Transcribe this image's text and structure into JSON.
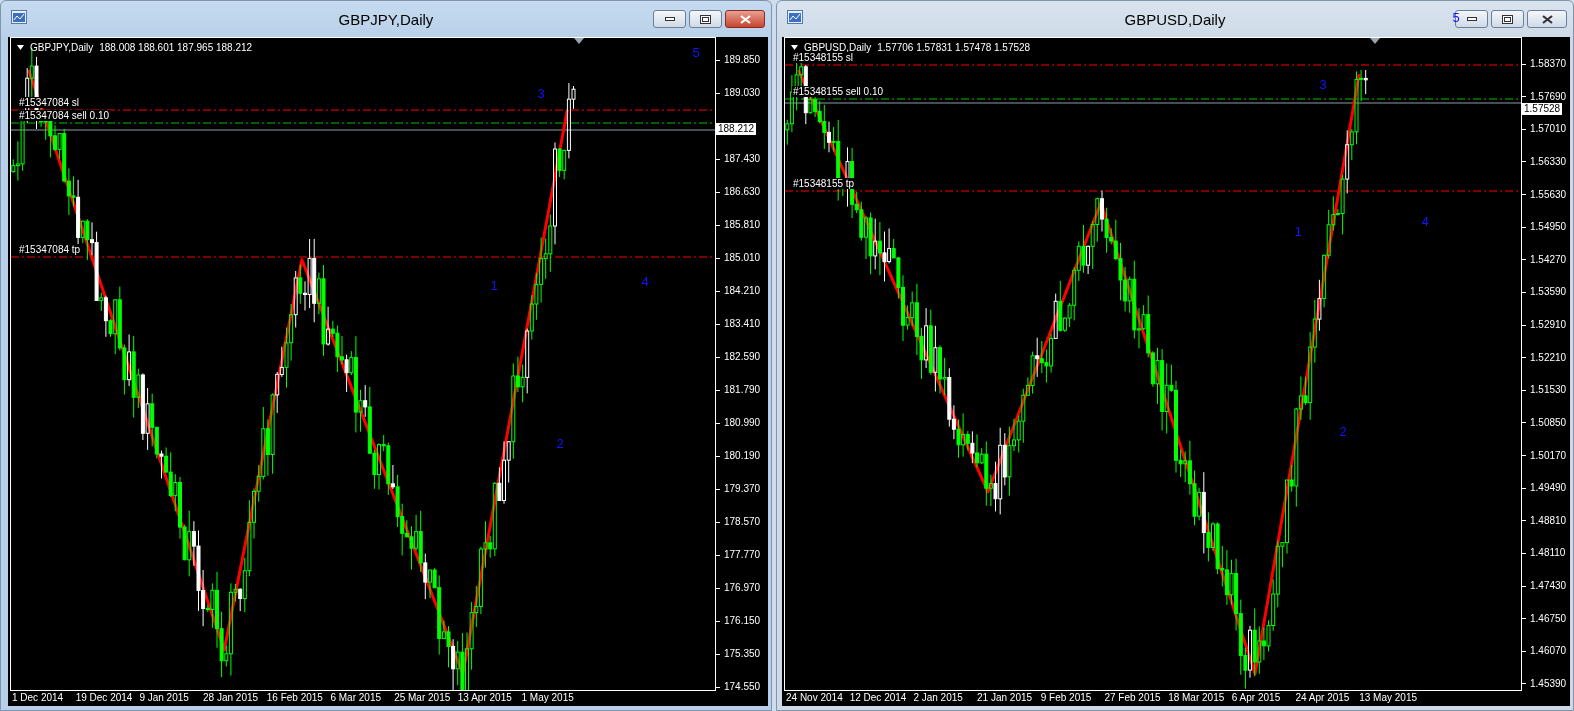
{
  "windows": [
    {
      "title": "GBPJPY,Daily",
      "active": true,
      "chart": {
        "symbol": "GBPJPY,Daily",
        "ohlc": "188.008 188.601 187.965 188.212",
        "current_price": "188.212",
        "orders": [
          {
            "kind": "sl",
            "label": "#15347084 sl"
          },
          {
            "kind": "entry",
            "label": "#15347084 sell 0.10"
          },
          {
            "kind": "tp",
            "label": "#15347084 tp"
          }
        ],
        "wave_labels": [
          "1",
          "2",
          "3",
          "4",
          "5"
        ],
        "price_ticks": [
          "189.850",
          "189.030",
          "187.430",
          "186.630",
          "185.810",
          "185.010",
          "184.210",
          "183.410",
          "182.590",
          "181.790",
          "180.990",
          "180.190",
          "179.370",
          "178.570",
          "177.770",
          "176.970",
          "176.150",
          "175.350",
          "174.550"
        ],
        "dates": [
          "1 Dec 2014",
          "19 Dec 2014",
          "9 Jan 2015",
          "28 Jan 2015",
          "16 Feb 2015",
          "6 Mar 2015",
          "25 Mar 2015",
          "13 Apr 2015",
          "1 May 2015"
        ]
      }
    },
    {
      "title": "GBPUSD,Daily",
      "active": false,
      "chart": {
        "symbol": "GBPUSD,Daily",
        "ohlc": "1.57706 1.57831 1.57478 1.57528",
        "current_price": "1.57528",
        "orders": [
          {
            "kind": "sl",
            "label": "#15348155 sl"
          },
          {
            "kind": "entry",
            "label": "#15348155 sell 0.10"
          },
          {
            "kind": "tp",
            "label": "#15348155 tp"
          }
        ],
        "wave_labels": [
          "1",
          "2",
          "3",
          "4",
          "5"
        ],
        "price_ticks": [
          "1.58370",
          "1.57690",
          "1.57010",
          "1.56330",
          "1.55630",
          "1.54950",
          "1.54270",
          "1.53590",
          "1.52910",
          "1.52210",
          "1.51530",
          "1.50850",
          "1.50170",
          "1.49490",
          "1.48810",
          "1.48110",
          "1.47430",
          "1.46750",
          "1.46070",
          "1.45390"
        ],
        "dates": [
          "24 Nov 2014",
          "12 Dec 2014",
          "2 Jan 2015",
          "21 Jan 2015",
          "9 Feb 2015",
          "27 Feb 2015",
          "18 Mar 2015",
          "6 Apr 2015",
          "24 Apr 2015",
          "13 May 2015"
        ]
      }
    }
  ]
}
